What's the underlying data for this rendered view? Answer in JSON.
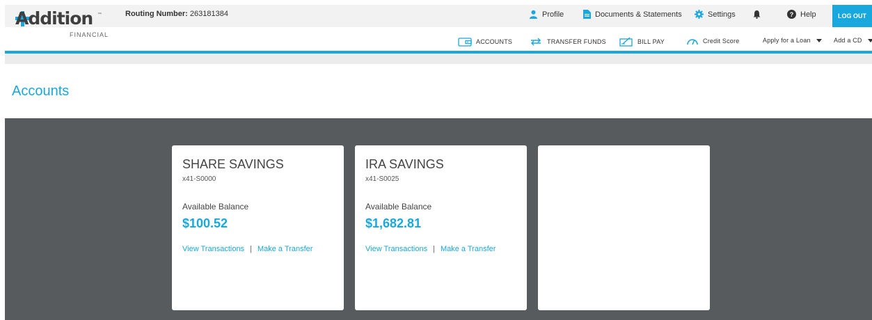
{
  "brand": {
    "logo_word": "Addition",
    "logo_sub": "FINANCIAL",
    "logo_tm": "™",
    "accent_color": "#19a8dd",
    "dark_color": "#585b5e"
  },
  "topbar": {
    "routing_label": "Routing Number:",
    "routing_value": "263181384",
    "links": {
      "profile": "Profile",
      "documents": "Documents & Statements",
      "settings": "Settings",
      "help": "Help",
      "logout": "LOG OUT"
    },
    "icons": [
      "user-icon",
      "document-icon",
      "gear-icon",
      "bell-icon",
      "help-icon"
    ]
  },
  "nav": {
    "accounts": "ACCOUNTS",
    "transfer": "TRANSFER FUNDS",
    "billpay": "BILL PAY",
    "credit": "Credit Score",
    "loan": "Apply for a Loan",
    "cd": "Add a CD"
  },
  "page": {
    "title": "Accounts"
  },
  "cards": [
    {
      "name": "SHARE SAVINGS",
      "number": "x41-S0000",
      "balance_label": "Available Balance",
      "balance": "$100.52",
      "link_transactions": "View Transactions",
      "link_separator": "|",
      "link_transfer": "Make a Transfer"
    },
    {
      "name": "IRA SAVINGS",
      "number": "x41-S0025",
      "balance_label": "Available Balance",
      "balance": "$1,682.81",
      "link_transactions": "View Transactions",
      "link_separator": "|",
      "link_transfer": "Make a Transfer"
    }
  ]
}
